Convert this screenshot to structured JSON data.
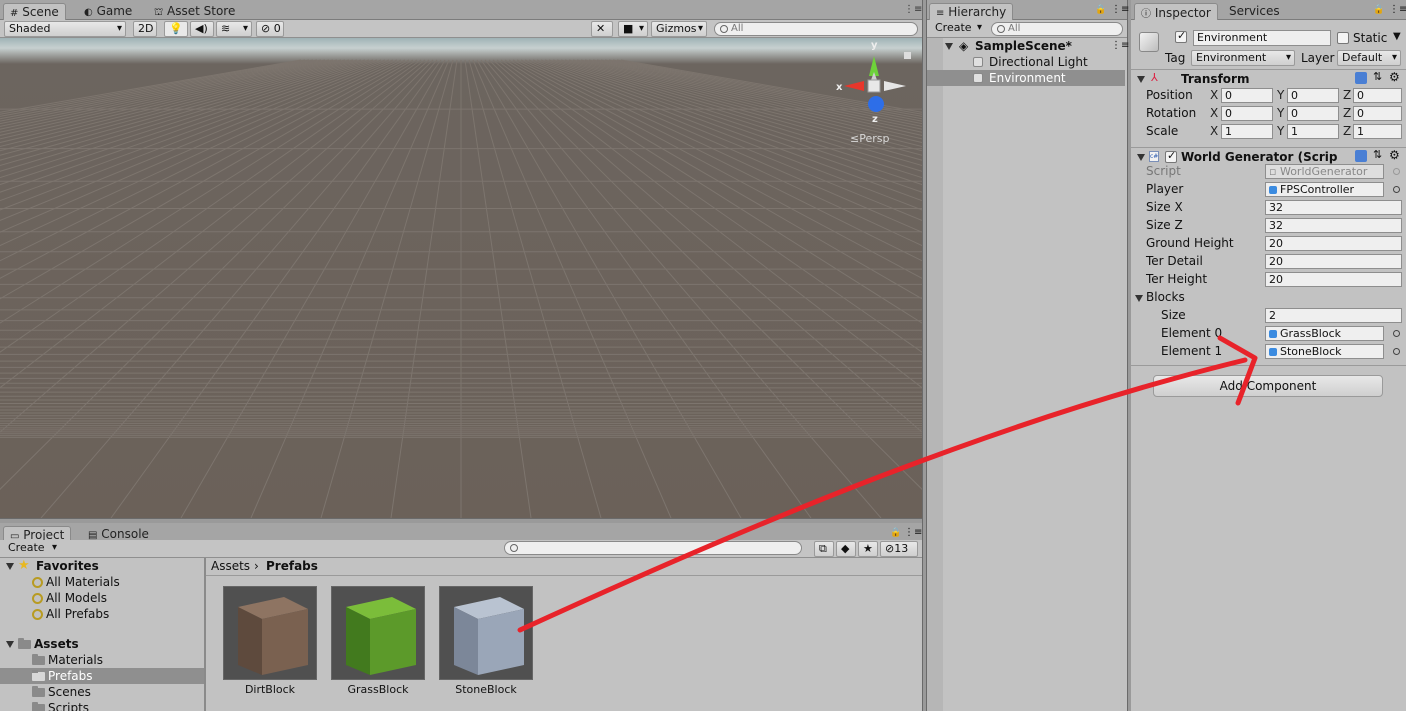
{
  "scene_tabs": {
    "scene": "Scene",
    "game": "Game",
    "asset_store": "Asset Store"
  },
  "scene_toolbar": {
    "shading": "Shaded",
    "mode_2d": "2D",
    "hidden_count": "0",
    "gizmos": "Gizmos",
    "search_placeholder": "All"
  },
  "gizmo": {
    "y": "y",
    "x": "x",
    "z": "z",
    "projection": "Persp"
  },
  "hierarchy": {
    "tab": "Hierarchy",
    "create": "Create",
    "search_placeholder": "All",
    "scene_name": "SampleScene*",
    "items": [
      {
        "label": "Directional Light"
      },
      {
        "label": "Environment"
      }
    ]
  },
  "inspector": {
    "tabs": {
      "inspector": "Inspector",
      "services": "Services"
    },
    "object_name": "Environment",
    "static_label": "Static",
    "tag_label": "Tag",
    "tag_value": "Environment",
    "layer_label": "Layer",
    "layer_value": "Default",
    "transform": {
      "title": "Transform",
      "axes": [
        "X",
        "Y",
        "Z"
      ],
      "rows": [
        {
          "label": "Position",
          "x": "0",
          "y": "0",
          "z": "0"
        },
        {
          "label": "Rotation",
          "x": "0",
          "y": "0",
          "z": "0"
        },
        {
          "label": "Scale",
          "x": "1",
          "y": "1",
          "z": "1"
        }
      ]
    },
    "world_generator": {
      "title": "World Generator (Scrip",
      "script_label": "Script",
      "script_value": "WorldGenerator",
      "player_label": "Player",
      "player_value": "FPSController",
      "size_x_label": "Size X",
      "size_x": "32",
      "size_z_label": "Size Z",
      "size_z": "32",
      "ground_height_label": "Ground Height",
      "ground_height": "20",
      "ter_detail_label": "Ter Detail",
      "ter_detail": "20",
      "ter_height_label": "Ter Height",
      "ter_height": "20",
      "blocks_label": "Blocks",
      "blocks_size_label": "Size",
      "blocks_size": "2",
      "element0_label": "Element 0",
      "element0": "GrassBlock",
      "element1_label": "Element 1",
      "element1": "StoneBlock"
    },
    "add_component": "Add Component"
  },
  "project": {
    "tabs": {
      "project": "Project",
      "console": "Console"
    },
    "create": "Create",
    "count": "13",
    "favorites_label": "Favorites",
    "favorites": [
      {
        "label": "All Materials"
      },
      {
        "label": "All Models"
      },
      {
        "label": "All Prefabs"
      }
    ],
    "assets_label": "Assets",
    "folders": [
      {
        "label": "Materials"
      },
      {
        "label": "Prefabs"
      },
      {
        "label": "Scenes"
      },
      {
        "label": "Scripts"
      }
    ],
    "breadcrumb": {
      "root": "Assets",
      "current": "Prefabs"
    },
    "prefabs": [
      {
        "label": "DirtBlock",
        "color": "#7a6150"
      },
      {
        "label": "GrassBlock",
        "color": "#5c9a2a"
      },
      {
        "label": "StoneBlock",
        "color": "#9aa6b8"
      }
    ]
  },
  "colors": {
    "annotation_arrow": "#e8232a",
    "selection": "#8f8f8f",
    "accent": "#3b8be0"
  }
}
